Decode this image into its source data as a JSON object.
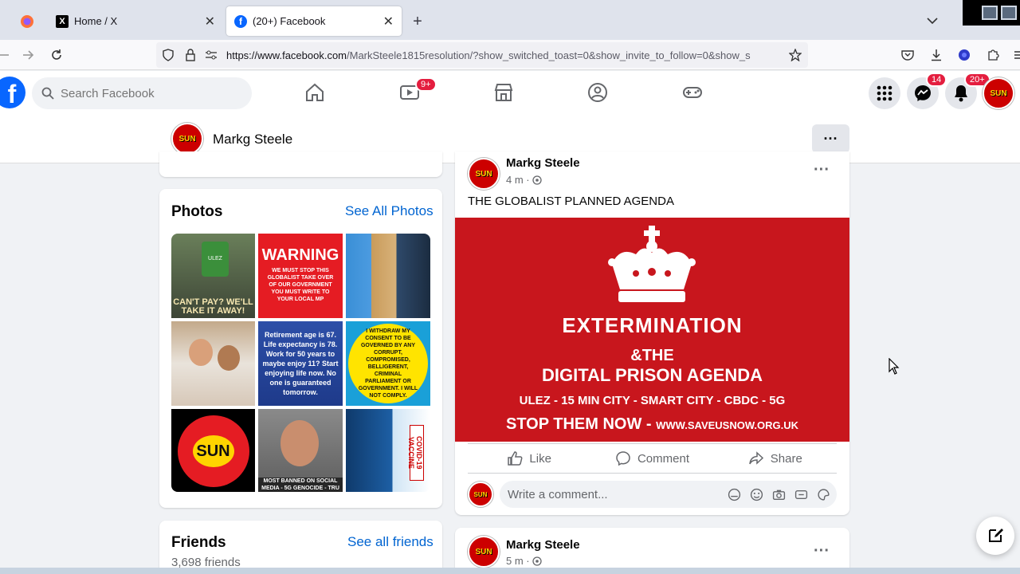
{
  "browser": {
    "tabs": [
      {
        "title": "Home / X"
      },
      {
        "title": "(20+) Facebook"
      }
    ],
    "new_tab": "+",
    "url_domain": "https://www.facebook.com",
    "url_path": "/MarkSteele1815resolution/?show_switched_toast=0&show_invite_to_follow=0&show_s"
  },
  "header": {
    "logo": "f",
    "search_placeholder": "Search Facebook",
    "video_badge": "9+",
    "messenger_badge": "14",
    "notif_badge": "20+"
  },
  "profile_bar": {
    "name": "Markg Steele",
    "more": "···"
  },
  "photos_card": {
    "title": "Photos",
    "see_all": "See All Photos",
    "tiles": [
      {
        "text": "CAN'T PAY? WE'LL TAKE IT AWAY!",
        "sub": "ULEZ"
      },
      {
        "text": "WARNING",
        "sub": "WE MUST STOP THIS GLOBALIST TAKE OVER OF OUR GOVERNMENT YOU MUST WRITE TO YOUR LOCAL MP"
      },
      {
        "text": ""
      },
      {
        "text": ""
      },
      {
        "text": "Retirement age is 67. Life expectancy is 78. Work for 50 years to maybe enjoy 11? Start enjoying life now. No one is guaranteed tomorrow."
      },
      {
        "text": "I WITHDRAW MY CONSENT TO BE GOVERNED BY ANY CORRUPT, COMPROMISED, BELLIGERENT, CRIMINAL PARLIAMENT OR GOVERNMENT. I WILL NOT COMPLY."
      },
      {
        "text": "SUN"
      },
      {
        "text": "MOST BANNED ON SOCIAL MEDIA - 5G GENOCIDE - TRU"
      },
      {
        "text": "COVID-19 VACCINE"
      }
    ]
  },
  "friends_card": {
    "title": "Friends",
    "see_all": "See all friends",
    "count": "3,698 friends"
  },
  "post": {
    "author": "Markg Steele",
    "time": "4 m ·",
    "text": "THE GLOBALIST PLANNED AGENDA",
    "image": {
      "line1": "EXTERMINATION",
      "line2": "&THE",
      "line3": "DIGITAL PRISON AGENDA",
      "line4": "ULEZ - 15 MIN CITY - SMART CITY - CBDC - 5G",
      "line5": "STOP THEM NOW - ",
      "line5b": "WWW.SAVEUSNOW.ORG.UK"
    },
    "like": "Like",
    "comment": "Comment",
    "share": "Share",
    "comment_placeholder": "Write a comment..."
  },
  "post2": {
    "author": "Markg Steele",
    "time": "5 m ·"
  },
  "avatar_text": "SUN",
  "colors": {
    "fb_blue": "#0866ff",
    "badge_red": "#e41e3f",
    "post_red": "#c8161d"
  }
}
